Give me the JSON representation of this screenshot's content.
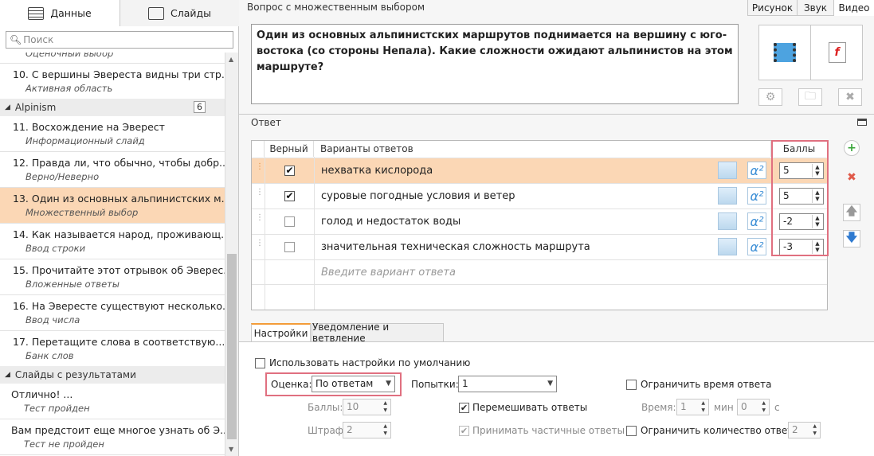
{
  "left": {
    "tabs": [
      {
        "label": "Данные",
        "icon": "list-icon"
      },
      {
        "label": "Слайды",
        "icon": "slides-icon"
      }
    ],
    "search_placeholder": "Поиск",
    "partial_top": "Оценочный выбор",
    "items_a": [
      {
        "title": "10. С вершины Эвереста видны три стр...",
        "subtitle": "Активная область"
      }
    ],
    "group_alpinism": {
      "label": "Alpinism",
      "count": "6"
    },
    "items_b": [
      {
        "title": "11. Восхождение на Эверест",
        "subtitle": "Информационный слайд"
      },
      {
        "title": "12. Правда ли, что обычно, чтобы добр...",
        "subtitle": "Верно/Неверно"
      },
      {
        "title": "13. Один из основных альпинистских м...",
        "subtitle": "Множественный выбор"
      },
      {
        "title": "14. Как называется народ, проживающ...",
        "subtitle": "Ввод строки"
      },
      {
        "title": "15. Прочитайте этот отрывок об Эверес...",
        "subtitle": "Вложенные ответы"
      },
      {
        "title": "16. На Эвересте существуют несколько...",
        "subtitle": "Ввод числа"
      },
      {
        "title": "17. Перетащите слова в соответствую...",
        "subtitle": "Банк слов"
      }
    ],
    "group_results": {
      "label": "Слайды с результатами"
    },
    "items_c": [
      {
        "title": "Отлично! ...",
        "subtitle": "Тест пройден"
      },
      {
        "title": "Вам предстоит еще многое узнать об Э...",
        "subtitle": "Тест не пройден"
      }
    ]
  },
  "question": {
    "header": "Вопрос с множественным выбором",
    "text": "Один из основных альпинистских маршрутов поднимается на вершину с юго-востока (со стороны Непала). Какие сложности ожидают альпинистов на этом маршруте?"
  },
  "media_tabs": [
    "Рисунок",
    "Звук",
    "Видео"
  ],
  "answers": {
    "header": "Ответ",
    "col_correct": "Верный",
    "col_options": "Варианты ответов",
    "col_points": "Баллы",
    "rows": [
      {
        "text": "нехватка кислорода",
        "checked": true,
        "points": "5"
      },
      {
        "text": "суровые погодные условия и ветер",
        "checked": true,
        "points": "5"
      },
      {
        "text": "голод и недостаток воды",
        "checked": false,
        "points": "-2"
      },
      {
        "text": "значительная техническая сложность маршрута",
        "checked": false,
        "points": "-3"
      }
    ],
    "placeholder": "Введите вариант ответа"
  },
  "settings": {
    "tabs": [
      "Настройки",
      "Уведомление и ветвление"
    ],
    "use_default": "Использовать настройки по умолчанию",
    "grading_label": "Оценка:",
    "grading_value": "По ответам",
    "points_label": "Баллы:",
    "points_value": "10",
    "penalty_label": "Штраф:",
    "penalty_value": "2",
    "attempts_label": "Попытки:",
    "attempts_value": "1",
    "shuffle_label": "Перемешивать ответы",
    "partial_label": "Принимать частичные ответы",
    "limit_time_label": "Ограничить время ответа",
    "time_label": "Время:",
    "time_min": "1",
    "min_label": "мин",
    "time_sec": "0",
    "sec_label": "с",
    "limit_count_label": "Ограничить количество ответов:",
    "limit_count_value": "2"
  }
}
